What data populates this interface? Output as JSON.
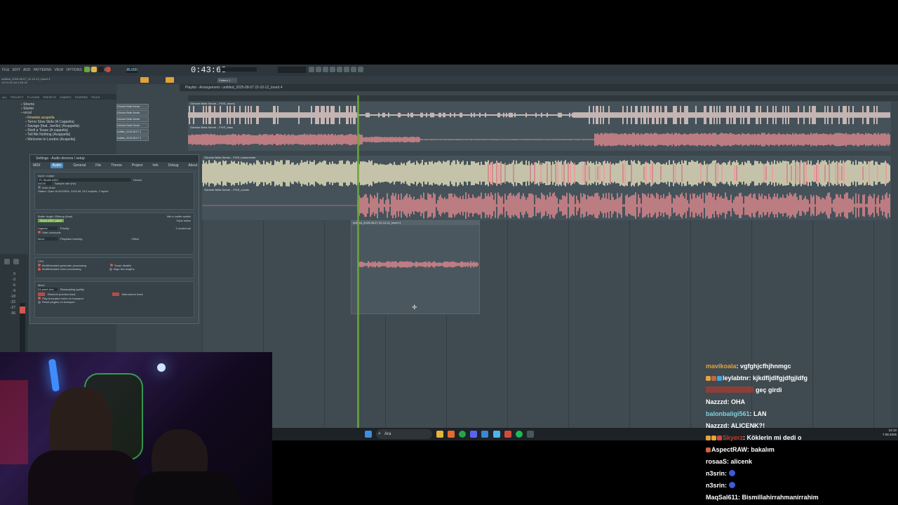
{
  "fl": {
    "menu": [
      "FILE",
      "EDIT",
      "ADD",
      "PATTERNS",
      "VIEW",
      "OPTIONS",
      "TOOLS",
      "HELP"
    ],
    "time": "0:43:68",
    "tempo": "85.000",
    "pattern": "Pattern 1",
    "hint_lines": [
      "untitled_2025-08-07_22-10-12_Insert 4",
      "10:14:16 Vol 4:03:16"
    ],
    "playlist_title": "Playlist - Arrangement › untitled_2025-08-07 22-10-12_Insert 4",
    "browser_tabs": [
      "ALL",
      "PROJECT",
      "PLUGINS",
      "PRESETS",
      "SNARES",
      "STARRED",
      "PICKS"
    ],
    "browser_items": [
      "Strums",
      "Starter",
      "vocal",
      "Rowdan acapella",
      "Terror Slow Slide (A Cappella)",
      "Savage (feat. Jamilo) (Acappella)",
      "Shell a Tease (A cappella)",
      "Tell Me Nothing (Acappella)",
      "Welcome to London (Acapella)"
    ],
    "channels": [
      "Gönüne Bella Sende",
      "Gönüne Bella Sende",
      "Gönüne Bella Sende",
      "Gönüne Bella Sende",
      "untitled_2025-08-07 2",
      "untitled_2025-08-07 2"
    ],
    "tracks": [
      {
        "name": "Gönüne Bella Sende – FIVE_drums"
      },
      {
        "name": "Gönüne Bella Sende – FIVE_bass"
      },
      {
        "name": "Gönüne Bella Sende – FIVE_instruments"
      },
      {
        "name": "Gönüne Bella Sende – FIVE_vocals"
      }
    ],
    "clip_name": "untitled_2025-08-07 22-10-12_Insert 4",
    "settings": {
      "title": "Settings - Audio devices / setup",
      "tabs": [
        "MIDI",
        "Audio",
        "General",
        "File",
        "Theme",
        "Project",
        "Info",
        "Debug",
        "About"
      ],
      "active_tab": "Audio",
      "input_output": "Input / output",
      "device": "FL Studio ASIO",
      "device_label": "Device",
      "sample_rate": "44100",
      "sample_rate_label": "Sample rate (Hz)",
      "auto_close": "Auto close",
      "status": "Status: Open at 44100Hz, 2x32 bit, 512 outputs, 2 inputs",
      "buffer": "Buffer length 256smp (6ms)",
      "show_asio": "Show ASIO panel",
      "mix_buffer": "Mix in buffer switch",
      "triple_buffer": "Triple buffer",
      "priority": "Highest",
      "priority_label": "Priority",
      "underruns": "0 underruns",
      "safe_overloads": "Safe overloads",
      "tracking": "Mixer",
      "tracking_label": "Playback tracking",
      "offset": "Offset",
      "cpu": "CPU",
      "multi_gen": "Multithreaded generator processing",
      "multi_mix": "Multithreaded mixer processing",
      "smart_disable": "Smart disable",
      "align_tick": "Align tick lengths",
      "mixer": "Mixer",
      "interp": "24-point sinc",
      "interp_label": "Resampling quality",
      "preview_track": "Reserve preview track",
      "metronome_track": "Metronome track",
      "play_truncated": "Play truncated notes on transport",
      "reset_plugins": "Reset plugins on transport"
    },
    "mixer_levels": [
      "0",
      "-3",
      "-6",
      "-9",
      "-18",
      "-22",
      "-27",
      "-36"
    ]
  },
  "taskbar": {
    "search_placeholder": "Ara",
    "clock_time": "22:10",
    "clock_date": "7.08.2025"
  },
  "chat": [
    {
      "user": "mavikoala",
      "color": "#e6a23c",
      "text": "vgfghjcfhjhnmgc",
      "badges": []
    },
    {
      "user": "leylabtnr",
      "color": "#ffffff",
      "text": "kjkdfljdlfgjdfgjldfg",
      "badges": [
        "#e8a23a",
        "#c9653f",
        "#3fa8e8"
      ]
    },
    {
      "user": "",
      "color": "#c0392b",
      "text": "geç girdi",
      "badges": []
    },
    {
      "user": "Nazzzd",
      "color": "#ffffff",
      "text": "OHA",
      "badges": []
    },
    {
      "user": "balonbaligi561",
      "color": "#7fd2e0",
      "text": "LAN",
      "badges": []
    },
    {
      "user": "Nazzzd",
      "color": "#ffffff",
      "text": "ALICENK?!",
      "badges": []
    },
    {
      "user": "Skyerz",
      "color": "#c0392b",
      "text": "Köklerin mi dedi o",
      "badges": [
        "#e8a23a",
        "#e8a23a",
        "#d24a3c"
      ]
    },
    {
      "user": "AspectRAW",
      "color": "#ffffff",
      "text": "bakalım",
      "badges": [
        "#c9653f"
      ]
    },
    {
      "user": "rosaaS",
      "color": "#ffffff",
      "text": "alicenk",
      "badges": []
    },
    {
      "user": "n3srin",
      "color": "#ffffff",
      "text": "",
      "badges": [],
      "emoji": true
    },
    {
      "user": "n3srin",
      "color": "#ffffff",
      "text": "",
      "badges": [],
      "emoji": true
    },
    {
      "user": "MaqSal611",
      "color": "#ffffff",
      "text": "Bismillahirrahmanirrahim",
      "badges": []
    }
  ]
}
